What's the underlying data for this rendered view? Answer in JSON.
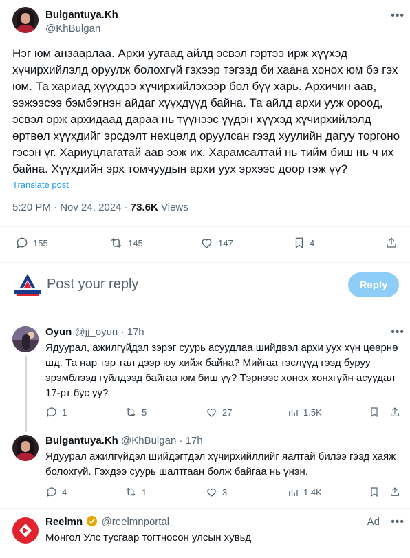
{
  "post": {
    "display_name": "Bulgantuya.Kh",
    "handle": "@KhBulgan",
    "text": "Нэг юм анзаарлаа. Архи уугаад айлд эсвэл гэртээ ирж хүүхэд хүчирхийлэлд оруулж болохгүй гэхээр тэгээд би хаана хонох юм бэ гэх юм. Та хариад хүүхдээ хүчирхийлэхээр бол бүү харь. Архичин аав, ээжээсээ бэмбэгнэн айдаг хүүхдүүд байна. Та айлд архи ууж ороод, эсвэл орж архидаад дараа нь түүнээс үүдэн хүүхэд хүчирхийлэлд өртвөл хүүхдийг эрсдэлт нөхцөлд оруулсан гээд хуулийн дагуу торгоно гэсэн үг. Хариуцлагатай аав ээж их. Харамсалтай нь тийм биш нь ч их байна. Хүүхдийн эрх томчуудын архи уух эрхээс доор гэж үү?",
    "translate_label": "Translate post",
    "time": "5:20 PM",
    "dot": "·",
    "date": "Nov 24, 2024",
    "views_count": "73.6K",
    "views_label": "Views",
    "stats": {
      "replies": "155",
      "reposts": "145",
      "likes": "147",
      "bookmarks": "4"
    }
  },
  "compose": {
    "placeholder": "Post your reply",
    "button_label": "Reply"
  },
  "comments": [
    {
      "name": "Oyun",
      "handle": "@jj_oyun",
      "time": "· 17h",
      "text": "Ядуурал, ажилгүйдэл зэрэг суурь асуудлаа шийдвэл архи уух хүн цөөрнө шд. Та нар тэр тал дээр юу хийж байна? Мийгаа тэслүүд гээд буруу эрэмблээд гүйлдээд байгаа юм биш үү? Тэрнээс хонох хонхгүйн асуудал 17-рт бус уу?",
      "replies": "1",
      "reposts": "5",
      "likes": "27",
      "views": "1.5K"
    },
    {
      "name": "Bulgantuya.Kh",
      "handle": "@KhBulgan",
      "time": "· 17h",
      "text": "Ядуурал ажилгүйдэл шийдэгтдэл хүчирхийллийг яалтай билээ гээд хаяж болохгүй. Гэхдээ суурь шалтгаан болж байгаа нь үнэн.",
      "replies": "4",
      "reposts": "1",
      "likes": "3",
      "views": "1.4K"
    }
  ],
  "ad": {
    "name": "Reelmn",
    "handle": "@reelmnportal",
    "label": "Ad",
    "text": "Монгол Улс тусгаар тогтносон улсын хувьд"
  },
  "colors": {
    "accent": "#1d9bf0",
    "reply_button": "#8ecdf7",
    "muted": "#536471",
    "ad_brand": "#e0232d"
  }
}
